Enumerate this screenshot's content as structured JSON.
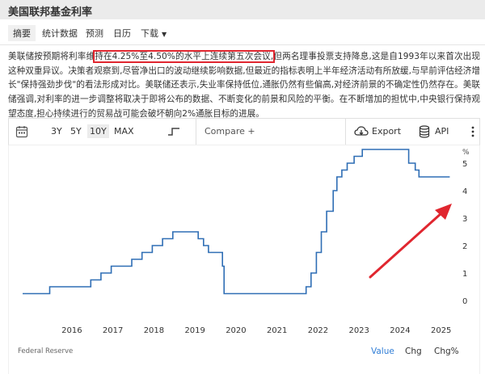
{
  "header": {
    "title": "美国联邦基金利率"
  },
  "nav": {
    "items": [
      {
        "label": "摘要",
        "active": true
      },
      {
        "label": "统计数据"
      },
      {
        "label": "预测"
      },
      {
        "label": "日历"
      },
      {
        "label": "下载",
        "dropdown": true
      }
    ]
  },
  "summary": {
    "before": "美联储按预期将利率维",
    "highlight": "持在4.25%至4.50%的水平上连续第五次会议,",
    "after": "但两名理事投票支持降息,这是自1993年以来首次出现这种双重异议。决策者观察到,尽管净出口的波动继续影响数据,但最近的指标表明上半年经济活动有所放缓,与早前评估经济增长\"保持强劲步伐\"的看法形成对比。美联储还表示,失业率保持低位,通胀仍然有些偏高,对经济前景的不确定性仍然存在。美联储强调,对利率的进一步调整将取决于即将公布的数据、不断变化的前景和风险的平衡。在不断增加的担忧中,中央银行保持观望态度,担心持续进行的贸易战可能会破坏朝向2%通胀目标的进展。"
  },
  "toolbar": {
    "ranges": [
      "3Y",
      "5Y",
      "10Y",
      "MAX"
    ],
    "active_range": "10Y",
    "compare_placeholder": "Compare +",
    "export_label": "Export",
    "api_label": "API",
    "icons": [
      "calendar-icon",
      "step-line-icon",
      "cloud-download-icon",
      "database-icon",
      "more-vertical-icon"
    ]
  },
  "chart_data": {
    "type": "line",
    "step": true,
    "title": "",
    "xlabel": "",
    "ylabel": "%",
    "ylim": [
      -0.8,
      5.75
    ],
    "xlim": [
      2015.3,
      2025.9
    ],
    "x_ticks": [
      "2016",
      "2017",
      "2018",
      "2019",
      "2020",
      "2021",
      "2022",
      "2023",
      "2024",
      "2025"
    ],
    "y_ticks": [
      0,
      1,
      2,
      3,
      4,
      5
    ],
    "grid": false,
    "line_color": "#2f6eb5",
    "series": [
      {
        "name": "",
        "points": [
          [
            2015.3,
            0.25
          ],
          [
            2015.96,
            0.5
          ],
          [
            2016.96,
            0.75
          ],
          [
            2017.21,
            1.0
          ],
          [
            2017.46,
            1.25
          ],
          [
            2017.96,
            1.5
          ],
          [
            2018.21,
            1.75
          ],
          [
            2018.46,
            2.0
          ],
          [
            2018.71,
            2.25
          ],
          [
            2018.96,
            2.5
          ],
          [
            2019.58,
            2.25
          ],
          [
            2019.71,
            2.0
          ],
          [
            2019.83,
            1.75
          ],
          [
            2020.17,
            1.25
          ],
          [
            2020.21,
            0.25
          ],
          [
            2022.21,
            0.5
          ],
          [
            2022.33,
            1.0
          ],
          [
            2022.46,
            1.75
          ],
          [
            2022.58,
            2.5
          ],
          [
            2022.71,
            3.25
          ],
          [
            2022.87,
            4.0
          ],
          [
            2022.96,
            4.5
          ],
          [
            2023.08,
            4.75
          ],
          [
            2023.21,
            5.0
          ],
          [
            2023.38,
            5.25
          ],
          [
            2023.58,
            5.5
          ],
          [
            2024.71,
            5.0
          ],
          [
            2024.87,
            4.75
          ],
          [
            2024.96,
            4.5
          ],
          [
            2025.71,
            4.5
          ]
        ]
      }
    ],
    "source": "Federal Reserve",
    "view_buttons": [
      "Value",
      "Chg",
      "Chg%"
    ],
    "active_view": "Value",
    "annotation_color": "#e0262f"
  }
}
